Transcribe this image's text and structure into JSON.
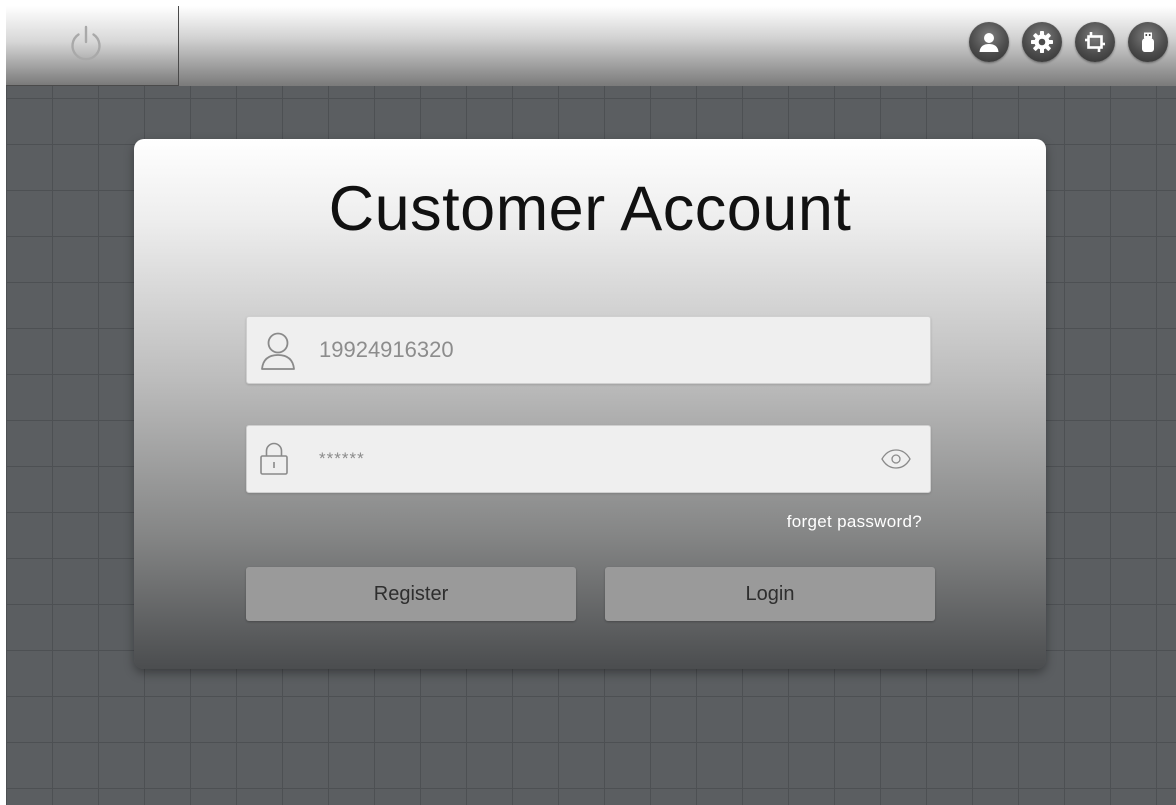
{
  "topbar": {
    "power_icon": "power-icon",
    "icons": [
      "user-icon",
      "gear-icon",
      "crop-icon",
      "usb-icon"
    ]
  },
  "login": {
    "title": "Customer Account",
    "username": {
      "value": "19924916320",
      "icon": "user-outline-icon"
    },
    "password": {
      "value": "******",
      "icon": "lock-icon",
      "toggle_icon": "eye-icon"
    },
    "forgot_label": "forget password?",
    "register_label": "Register",
    "login_label": "Login"
  },
  "colors": {
    "background": "#5b5e61",
    "grid_line": "#4d5053",
    "button": "#9a9a9a",
    "link": "#ffffff"
  }
}
